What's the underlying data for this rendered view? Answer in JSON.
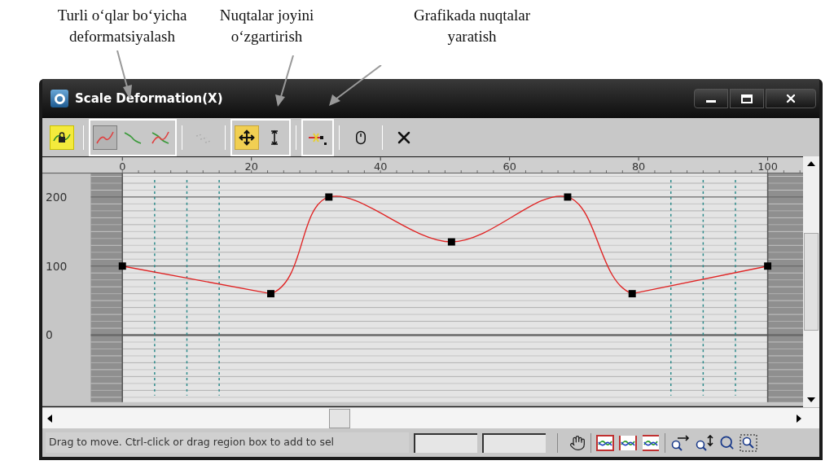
{
  "annotations": [
    {
      "text": "Turli o‘qlar bo‘yicha deformatsiyalash"
    },
    {
      "text": "Nuqtalar joyini o‘zgartirish"
    },
    {
      "text": "Grafikada nuqtalar yaratish"
    }
  ],
  "window": {
    "title": "Scale Deformation(X)"
  },
  "toolbar": [
    {
      "highlighted": false,
      "buttons": [
        {
          "kind": "lock",
          "selected": true,
          "disabled": false
        }
      ]
    },
    {
      "highlighted": true,
      "buttons": [
        {
          "kind": "curve-x",
          "selected": true,
          "disabled": false
        },
        {
          "kind": "curve-y",
          "selected": false,
          "disabled": false
        },
        {
          "kind": "curve-xy",
          "selected": false,
          "disabled": false
        }
      ]
    },
    {
      "highlighted": false,
      "buttons": [
        {
          "kind": "swap",
          "selected": false,
          "disabled": true
        }
      ]
    },
    {
      "highlighted": true,
      "buttons": [
        {
          "kind": "move",
          "selected": true,
          "disabled": false
        },
        {
          "kind": "scale",
          "selected": false,
          "disabled": false
        }
      ]
    },
    {
      "highlighted": true,
      "buttons": [
        {
          "kind": "insert",
          "selected": false,
          "disabled": false
        }
      ]
    },
    {
      "highlighted": false,
      "buttons": [
        {
          "kind": "reset",
          "selected": false,
          "disabled": false
        }
      ]
    },
    {
      "highlighted": false,
      "buttons": [
        {
          "kind": "delete",
          "selected": false,
          "disabled": false
        }
      ]
    }
  ],
  "chart_data": {
    "type": "line",
    "x": [
      0,
      23,
      32,
      51,
      69,
      79,
      100
    ],
    "series": [
      {
        "color": "#e02424",
        "marker": "square",
        "values": [
          100,
          60,
          200,
          135,
          200,
          60,
          100
        ]
      }
    ],
    "grid": true,
    "bands": [
      {
        "axis": "x",
        "from": -4.9,
        "to": 0,
        "color": "#8f8f8f"
      },
      {
        "axis": "x",
        "from": 0,
        "to": 100,
        "color": "#e4e4e4"
      },
      {
        "axis": "x",
        "from": 100,
        "to": 105.5,
        "color": "#8f8f8f"
      }
    ],
    "xlim": [
      -12.4,
      105.5
    ],
    "ylim": [
      -97,
      234
    ],
    "xticks": [
      0,
      20,
      40,
      60,
      80,
      100
    ],
    "yticks": [
      0,
      100,
      200
    ],
    "ref_lines": [
      {
        "axis": "x",
        "value": 5
      },
      {
        "axis": "x",
        "value": 10
      },
      {
        "axis": "x",
        "value": 15
      },
      {
        "axis": "x",
        "value": 85
      },
      {
        "axis": "x",
        "value": 90
      },
      {
        "axis": "x",
        "value": 95
      }
    ]
  },
  "status_bar": {
    "text": "Drag to move. Ctrl-click or drag region box to add to sel",
    "tools": [
      {
        "kind": "pan"
      },
      {
        "kind": "zoom-extents"
      },
      {
        "kind": "zoom-h-extents"
      },
      {
        "kind": "zoom-v-extents"
      },
      {
        "kind": "zoom-horizontal"
      },
      {
        "kind": "zoom-vertical"
      },
      {
        "kind": "zoom"
      },
      {
        "kind": "zoom-region"
      }
    ]
  }
}
